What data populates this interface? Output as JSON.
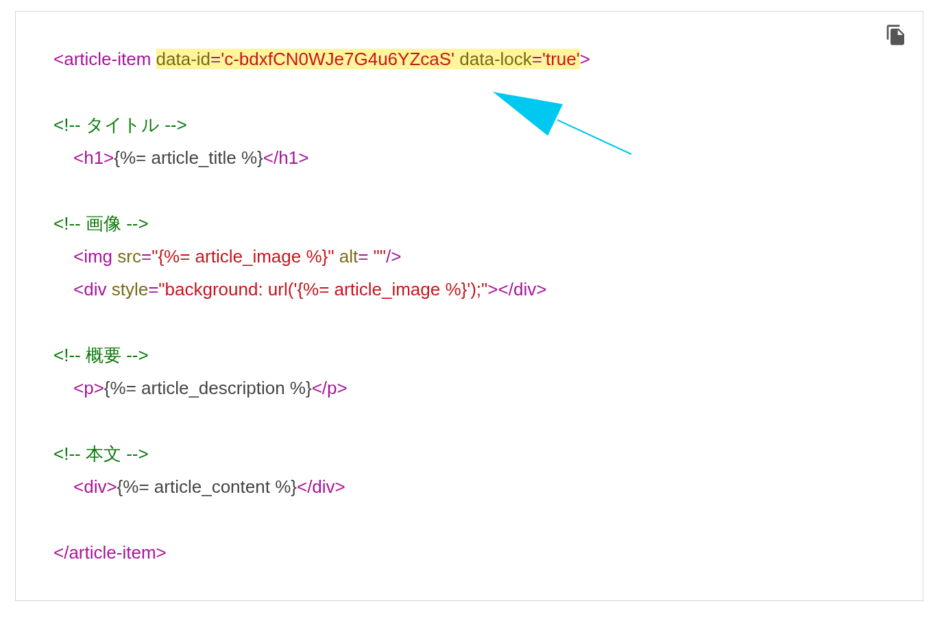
{
  "code_block": {
    "lines": [
      {
        "tokens": [
          {
            "kind": "tag",
            "text": "<article-item "
          },
          {
            "kind": "attr",
            "text": "data-id",
            "highlighted": true
          },
          {
            "kind": "tag",
            "text": "=",
            "highlighted": true
          },
          {
            "kind": "string",
            "text": "'c-bdxfCN0WJe7G4u6YZcaS'",
            "highlighted": true
          },
          {
            "kind": "attr",
            "text": " data-lock",
            "highlighted": true
          },
          {
            "kind": "tag",
            "text": "=",
            "highlighted": true
          },
          {
            "kind": "string",
            "text": "'true'",
            "highlighted": true
          },
          {
            "kind": "tag",
            "text": ">"
          }
        ]
      },
      {
        "tokens": [
          {
            "kind": "comment",
            "text": "<!-- タイトル -->"
          }
        ],
        "children": [
          {
            "tokens": [
              {
                "kind": "tag",
                "text": "<h1>"
              },
              {
                "kind": "plain",
                "text": "{%= article_title %}"
              },
              {
                "kind": "tag",
                "text": "</h1>"
              }
            ]
          }
        ]
      },
      {
        "tokens": [
          {
            "kind": "comment",
            "text": "<!-- 画像 -->"
          }
        ],
        "children": [
          {
            "tokens": [
              {
                "kind": "tag",
                "text": "<img "
              },
              {
                "kind": "attr",
                "text": "src"
              },
              {
                "kind": "tag",
                "text": "="
              },
              {
                "kind": "string",
                "text": "\"{%= article_image %}\""
              },
              {
                "kind": "attr",
                "text": " alt"
              },
              {
                "kind": "tag",
                "text": "="
              },
              {
                "kind": "string",
                "text": " \"\""
              },
              {
                "kind": "tag",
                "text": "/>"
              }
            ]
          },
          {
            "tokens": [
              {
                "kind": "tag",
                "text": "<div "
              },
              {
                "kind": "attr",
                "text": "style"
              },
              {
                "kind": "tag",
                "text": "="
              },
              {
                "kind": "string",
                "text": "\"background: url('{%= article_image %}');\""
              },
              {
                "kind": "tag",
                "text": "></div>"
              }
            ]
          }
        ]
      },
      {
        "tokens": [
          {
            "kind": "comment",
            "text": "<!-- 概要 -->"
          }
        ],
        "children": [
          {
            "tokens": [
              {
                "kind": "tag",
                "text": "<p>"
              },
              {
                "kind": "plain",
                "text": "{%= article_description %}"
              },
              {
                "kind": "tag",
                "text": "</p>"
              }
            ]
          }
        ]
      },
      {
        "tokens": [
          {
            "kind": "comment",
            "text": "<!-- 本文 -->"
          }
        ],
        "children": [
          {
            "tokens": [
              {
                "kind": "tag",
                "text": "<div>"
              },
              {
                "kind": "plain",
                "text": "{%= article_content %}"
              },
              {
                "kind": "tag",
                "text": "</div>"
              }
            ]
          }
        ]
      },
      {
        "tokens": [
          {
            "kind": "tag",
            "text": "</article-item>"
          }
        ]
      }
    ]
  }
}
